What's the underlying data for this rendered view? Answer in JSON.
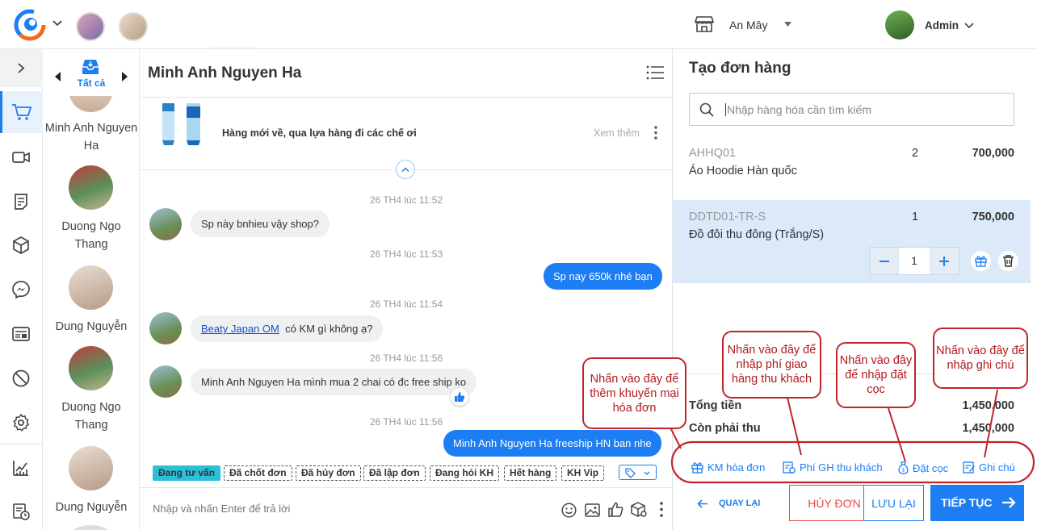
{
  "header": {
    "store_name": "An Mây",
    "user_name": "Admin"
  },
  "contacts": {
    "filter_label": "Tất cả",
    "items": [
      {
        "name_line1": "Minh Anh Nguyen",
        "name_line2": "Ha"
      },
      {
        "name_line1": "Duong Ngo",
        "name_line2": "Thang"
      },
      {
        "name_line1": "Dung Nguyễn",
        "name_line2": ""
      },
      {
        "name_line1": "Duong Ngo",
        "name_line2": "Thang"
      },
      {
        "name_line1": "Dung Nguyễn",
        "name_line2": ""
      }
    ]
  },
  "chat": {
    "title": "Minh Anh Nguyen Ha",
    "pinned_post": {
      "text": "Hàng mới về, qua lựa hàng đi các chế ơi",
      "action": "Xem thêm"
    },
    "messages": [
      {
        "time": "26 TH4 lúc 11:52",
        "text": "Sp này bnhieu vậy shop?"
      },
      {
        "time": "26 TH4 lúc 11:53",
        "text": "Sp nay 650k nhé bạn"
      },
      {
        "time": "26 TH4 lúc 11:54",
        "link": "Beaty Japan OM",
        "text": "có KM gì không ạ?"
      },
      {
        "time": "26 TH4 lúc 11:56",
        "text": "Minh Anh Nguyen Ha mình mua 2 chai có đc free ship ko"
      },
      {
        "time": "26 TH4 lúc 11:56",
        "text": "Minh Anh Nguyen Ha freeship HN ban nhe"
      }
    ],
    "tags": [
      "Đang tư vấn",
      "Đã chốt đơn",
      "Đã hủy đơn",
      "Đã lập đơn",
      "Đang hỏi KH",
      "Hết hàng",
      "KH Vip"
    ],
    "input_placeholder": "Nhập và nhấn Enter để trả lời"
  },
  "order": {
    "title": "Tạo đơn hàng",
    "search_placeholder": "Nhập hàng hóa cần tìm kiếm",
    "items": [
      {
        "code": "AHHQ01",
        "name": "Áo Hoodie Hàn quốc",
        "qty": "2",
        "price": "700,000"
      },
      {
        "code": "DDTD01-TR-S",
        "name": "Đồ đôi thu đông (Trắng/S)",
        "qty": "1",
        "price": "750,000",
        "stepper_value": "1"
      }
    ],
    "total_label": "Tổng tiền",
    "total_value": "1,450,000",
    "remaining_label": "Còn phải thu",
    "remaining_value": "1,450,000",
    "actions": {
      "discount": "KM hóa đơn",
      "shipping": "Phí GH thu khách",
      "deposit": "Đặt cọc",
      "note": "Ghi chú"
    },
    "buttons": {
      "back": "QUAY LẠI",
      "cancel": "HỦY ĐƠN",
      "save": "LƯU LẠI",
      "continue": "TIẾP TỤC"
    }
  },
  "callouts": {
    "discount": "Nhấn vào đây để thêm khuyến mại hóa đơn",
    "shipping": "Nhấn vào đây để nhập phí giao hàng thu khách",
    "deposit": "Nhấn vào đây để nhập đặt cọc",
    "note": "Nhấn vào đây để nhập ghi chú"
  },
  "colors": {
    "accent": "#1d7df2",
    "tag_active": "#2bc0d8",
    "callout": "#c0252a",
    "selected_row": "#dce9f9"
  }
}
